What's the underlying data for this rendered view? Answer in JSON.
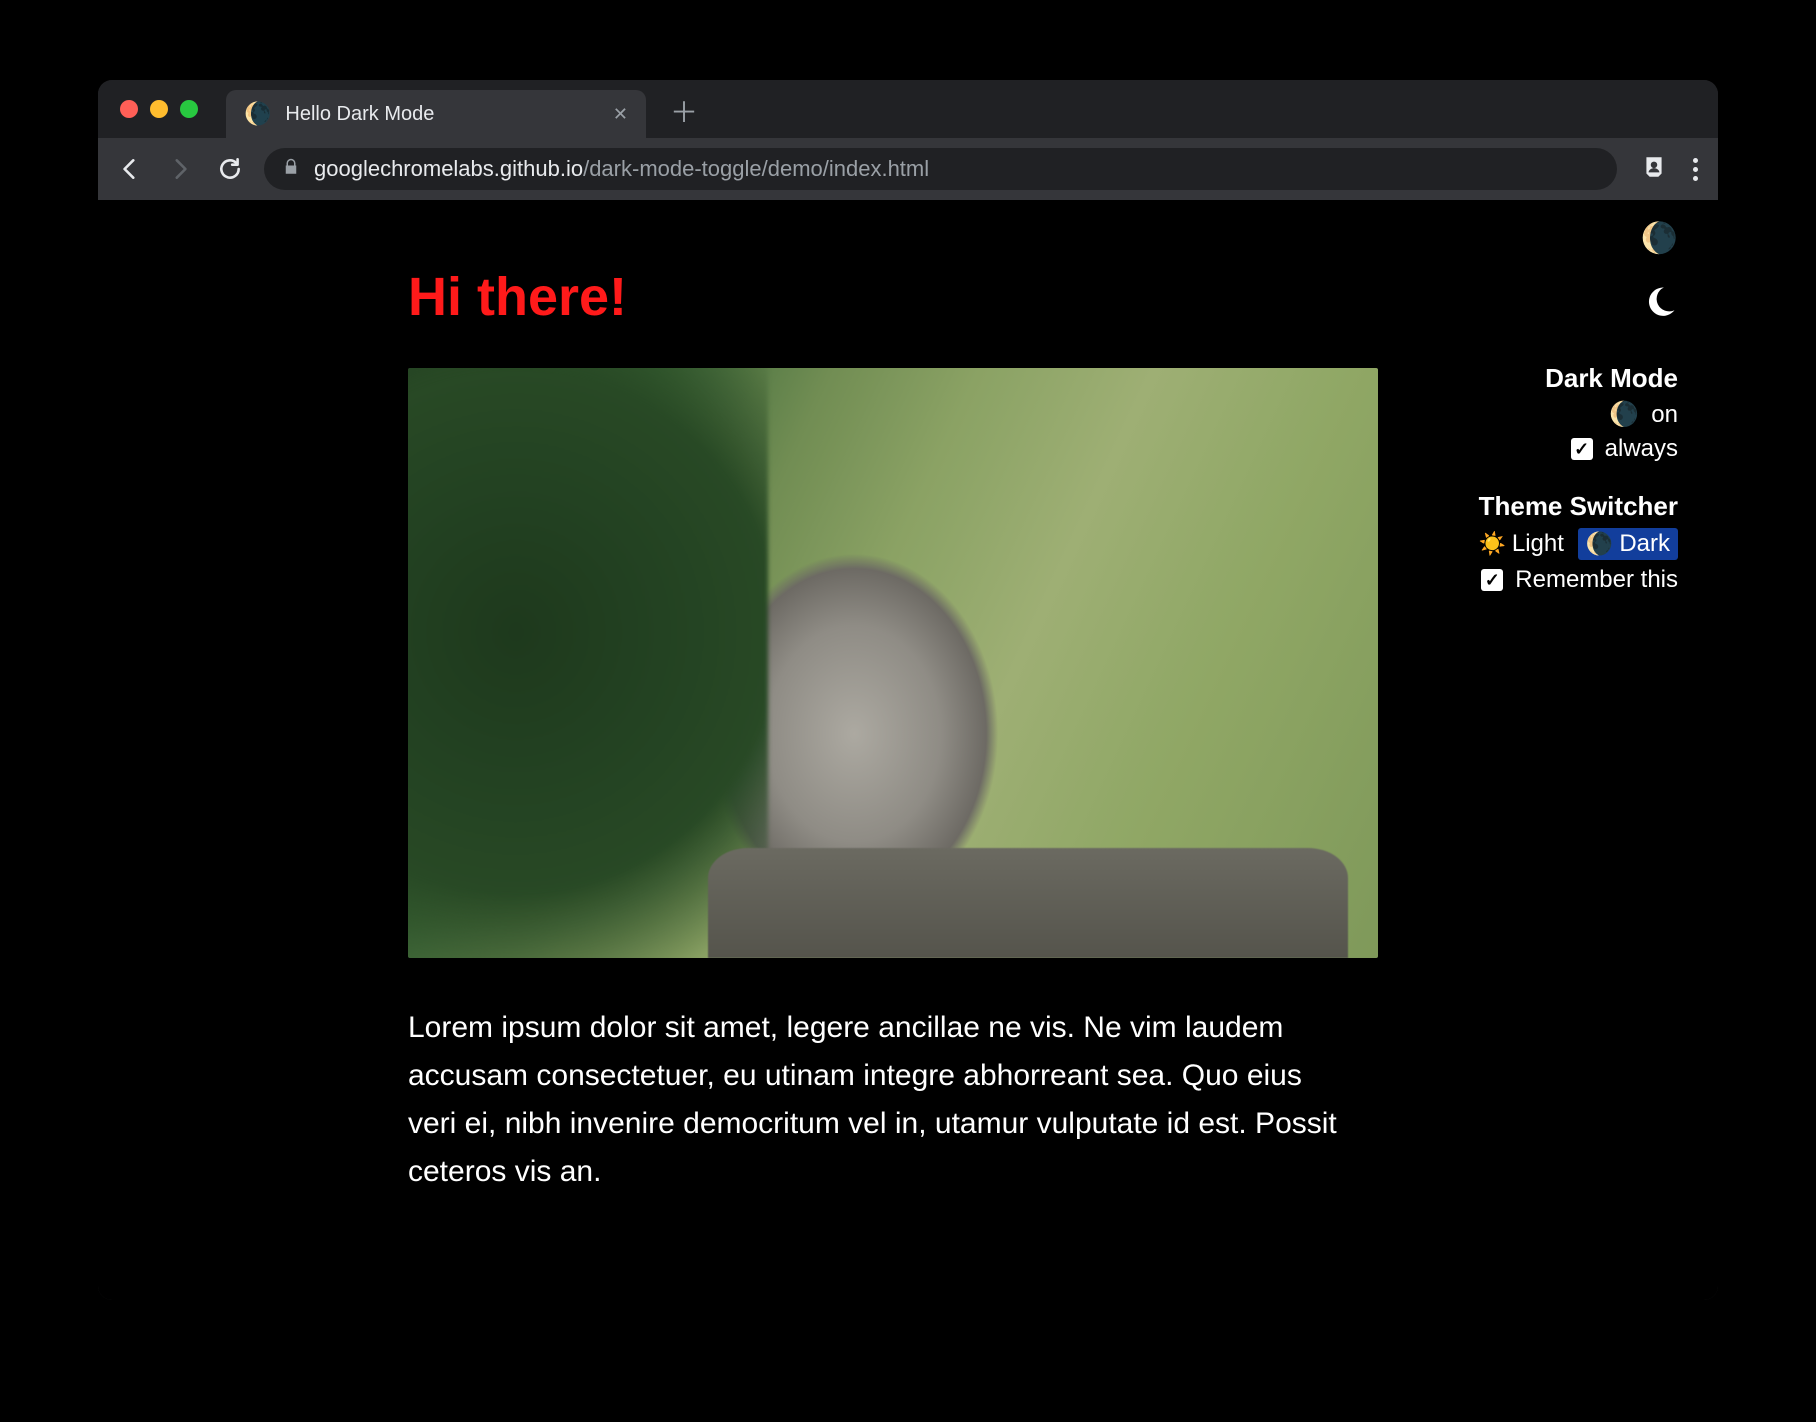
{
  "browser": {
    "tab": {
      "title": "Hello Dark Mode",
      "favicon": "🌘"
    },
    "url": {
      "host": "googlechromelabs.github.io",
      "path": "/dark-mode-toggle/demo/index.html"
    }
  },
  "page": {
    "heading": "Hi there!",
    "paragraph": "Lorem ipsum dolor sit amet, legere ancillae ne vis. Ne vim laudem accusam consectetuer, eu utinam integre abhorreant sea. Quo eius veri ei, nibh invenire democritum vel in, utamur vulputate id est. Possit ceteros vis an."
  },
  "controls": {
    "darkmode": {
      "title": "Dark Mode",
      "state_label": "on",
      "always_label": "always",
      "always_checked": true
    },
    "themeswitcher": {
      "title": "Theme Switcher",
      "light_label": "Light",
      "dark_label": "Dark",
      "selected": "dark",
      "remember_label": "Remember this",
      "remember_checked": true
    }
  },
  "icons": {
    "moon": "🌘",
    "sun": "☀️"
  }
}
